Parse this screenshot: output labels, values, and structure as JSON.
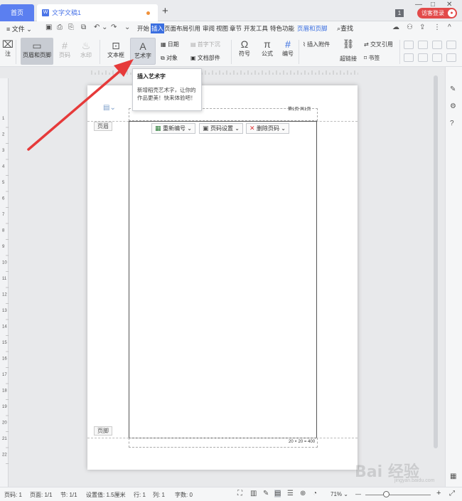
{
  "tabbar": {
    "home_tab": "首页",
    "doc_tab": "文字文稿1",
    "doc_icon": "W",
    "add_tab": "+",
    "badge_number": "1",
    "guest_login": "访客登录",
    "window_controls": [
      "—",
      "□",
      "✕"
    ]
  },
  "menubar": {
    "file": "文件",
    "quick_access_icons": [
      "menu-icon",
      "save-icon",
      "print-icon",
      "print-preview-icon",
      "export-icon",
      "undo-icon",
      "redo-icon"
    ],
    "tabs": [
      "开始",
      "插入",
      "页面布局",
      "引用",
      "审阅",
      "视图",
      "章节",
      "开发工具",
      "特色功能",
      "页眉和页脚"
    ],
    "active_tab": "插入",
    "context_tab": "页眉和页脚",
    "search": "查找",
    "collapse_icon": "^",
    "more_icon": "⋮"
  },
  "ribbon": {
    "header_footer": "页眉和页脚",
    "page_number": "页码",
    "watermark": "水印",
    "text_box": "文本框",
    "word_art": "艺术字",
    "date": "日期",
    "object": "对象",
    "doc_parts": "文档部件",
    "first_line_indent": "首字下沉",
    "symbol": "符号",
    "formula": "公式",
    "numbering": "编号",
    "insert_attachment": "插入附件",
    "hyperlink": "超链接",
    "cross_reference": "交叉引用",
    "bookmark": "书签",
    "left_note": "注"
  },
  "tooltip": {
    "title": "插入艺术字",
    "body": "新增稻壳艺术字，让你的作品更美！快来体验吧！"
  },
  "document": {
    "header_tag": "页眉",
    "footer_tag": "页脚",
    "header_right": "第1页 共1页",
    "footer_right": "20 × 20 = 400",
    "renumber_button": "重新编号",
    "page_number_settings_button": "页码设置",
    "delete_page_number_button": "删除页码",
    "para_mark": "↵"
  },
  "ruler": {
    "labels": [
      "1",
      "2",
      "3",
      "4",
      "5",
      "6",
      "7",
      "8",
      "9",
      "10",
      "11",
      "12",
      "13",
      "14",
      "15",
      "16",
      "17",
      "18",
      "19",
      "20",
      "21",
      "22"
    ]
  },
  "statusbar": {
    "page_no": "页码: 1",
    "pages": "页面: 1/1",
    "section": "节: 1/1",
    "setting": "设置值: 1.5厘米",
    "row": "行: 1",
    "col": "列: 1",
    "word_count": "字数: 0",
    "zoom": "71%",
    "zoom_minus": "—",
    "zoom_plus": "+"
  },
  "watermark": {
    "logo_text": "Bai  经验",
    "sub_text": "jingyan.baidu.com"
  },
  "colors": {
    "accent": "#3b6fe0",
    "home_tab": "#5b7ff0",
    "guest": "#e24a4a",
    "arrow": "#e63a3a"
  }
}
